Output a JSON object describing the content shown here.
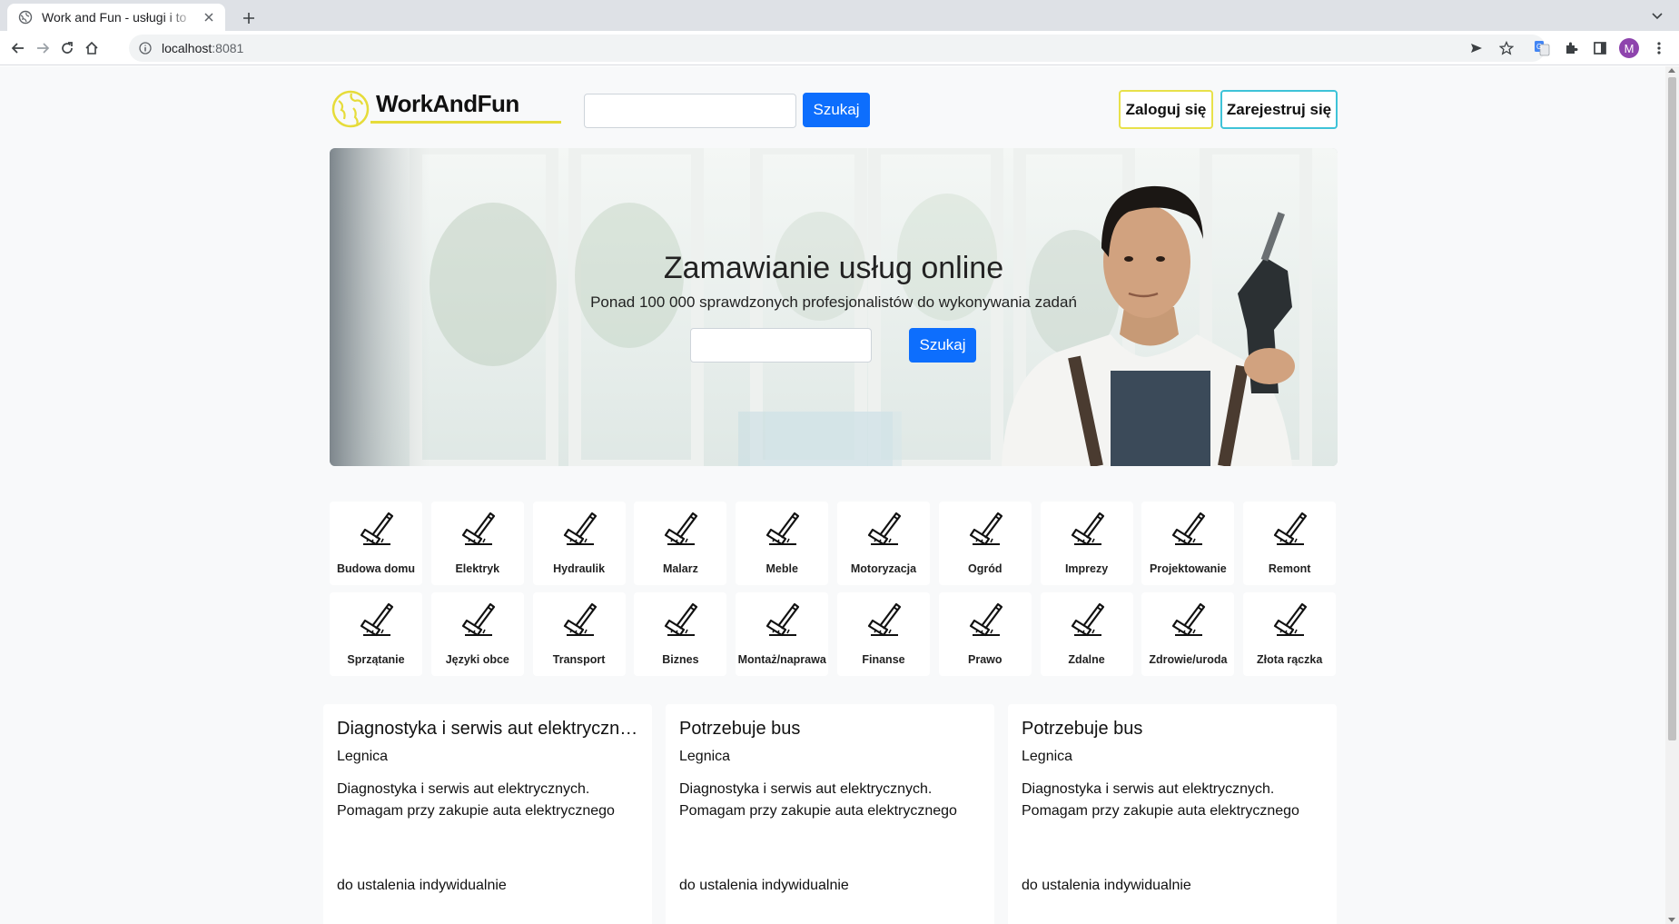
{
  "browser": {
    "tab_title": "Work and Fun - usługi i to",
    "url_host": "localhost",
    "url_port": ":8081",
    "avatar_letter": "M"
  },
  "navbar": {
    "logo_text": "WorkAndFun",
    "search_value": "",
    "search_button": "Szukaj",
    "login_button": "Zaloguj się",
    "register_button": "Zarejestruj się"
  },
  "hero": {
    "title": "Zamawianie usług online",
    "subtitle": "Ponad 100 000 sprawdzonych profesjonalistów do wykonywania zadań",
    "search_value": "",
    "search_button": "Szukaj"
  },
  "categories": [
    {
      "label": "Budowa domu",
      "icon": "hammer-icon"
    },
    {
      "label": "Elektryk",
      "icon": "hammer-icon"
    },
    {
      "label": "Hydraulik",
      "icon": "hammer-icon"
    },
    {
      "label": "Malarz",
      "icon": "hammer-icon"
    },
    {
      "label": "Meble",
      "icon": "hammer-icon"
    },
    {
      "label": "Motoryzacja",
      "icon": "hammer-icon"
    },
    {
      "label": "Ogród",
      "icon": "hammer-icon"
    },
    {
      "label": "Imprezy",
      "icon": "hammer-icon"
    },
    {
      "label": "Projektowanie",
      "icon": "hammer-icon"
    },
    {
      "label": "Remont",
      "icon": "hammer-icon"
    },
    {
      "label": "Sprzątanie",
      "icon": "hammer-icon"
    },
    {
      "label": "Języki obce",
      "icon": "hammer-icon"
    },
    {
      "label": "Transport",
      "icon": "hammer-icon"
    },
    {
      "label": "Biznes",
      "icon": "hammer-icon"
    },
    {
      "label": "Montaż/naprawa",
      "icon": "hammer-icon"
    },
    {
      "label": "Finanse",
      "icon": "hammer-icon"
    },
    {
      "label": "Prawo",
      "icon": "hammer-icon"
    },
    {
      "label": "Zdalne",
      "icon": "hammer-icon"
    },
    {
      "label": "Zdrowie/uroda",
      "icon": "hammer-icon"
    },
    {
      "label": "Złota rączka",
      "icon": "hammer-icon"
    }
  ],
  "listings": [
    {
      "title": "Diagnostyka i serwis aut elektrycznych",
      "city": "Legnica",
      "description_line1": "Diagnostyka i serwis aut elektrycznych.",
      "description_line2": "Pomagam przy zakupie auta elektrycznego",
      "price": "do ustalenia indywidualnie"
    },
    {
      "title": "Potrzebuje bus",
      "city": "Legnica",
      "description_line1": "Diagnostyka i serwis aut elektrycznych.",
      "description_line2": "Pomagam przy zakupie auta elektrycznego",
      "price": "do ustalenia indywidualnie"
    },
    {
      "title": "Potrzebuje bus",
      "city": "Legnica",
      "description_line1": "Diagnostyka i serwis aut elektrycznych.",
      "description_line2": "Pomagam przy zakupie auta elektrycznego",
      "price": "do ustalenia indywidualnie"
    }
  ],
  "colors": {
    "primary": "#0d6efd",
    "login_border": "#e8e14a",
    "register_border": "#3ec3d8",
    "logo_accent": "#e6dc3a",
    "page_bg": "#f8f9fa"
  }
}
